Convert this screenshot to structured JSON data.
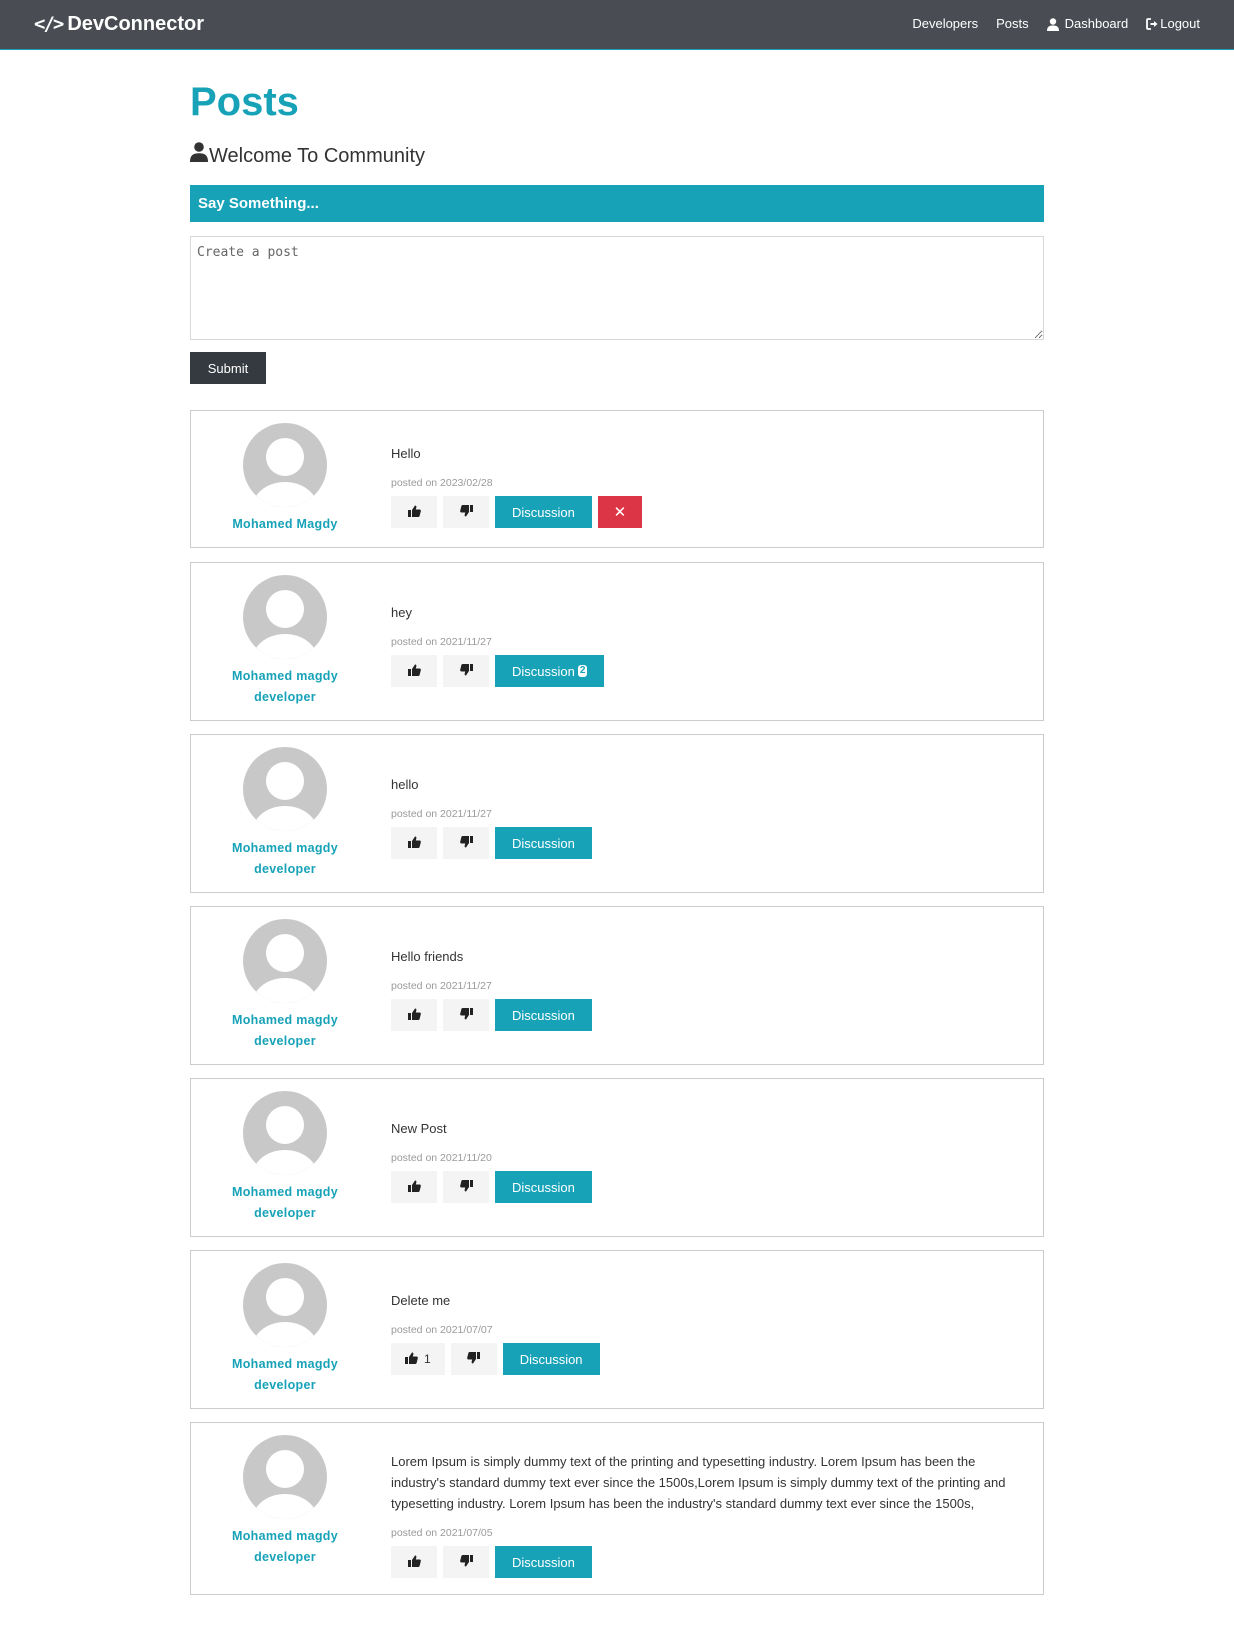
{
  "navbar": {
    "brand": "DevConnector",
    "links": [
      {
        "label": "Developers"
      },
      {
        "label": "Posts"
      },
      {
        "label": "Dashboard"
      },
      {
        "label": "Logout"
      }
    ]
  },
  "page": {
    "title": "Posts",
    "lead": "Welcome To Community"
  },
  "form": {
    "header": "Say Something...",
    "placeholder": "Create a post",
    "submit_label": "Submit"
  },
  "posts": [
    {
      "name": "Mohamed Magdy",
      "role": "",
      "text": "Hello",
      "date": "posted on 2023/02/28",
      "likes": "",
      "discussion": "Discussion",
      "comments": "",
      "deletable": true
    },
    {
      "name": "Mohamed magdy",
      "role": "developer",
      "text": "hey",
      "date": "posted on 2021/11/27",
      "likes": "",
      "discussion": "Discussion",
      "comments": "2",
      "deletable": false
    },
    {
      "name": "Mohamed magdy",
      "role": "developer",
      "text": "hello",
      "date": "posted on 2021/11/27",
      "likes": "",
      "discussion": "Discussion",
      "comments": "",
      "deletable": false
    },
    {
      "name": "Mohamed magdy",
      "role": "developer",
      "text": "Hello friends",
      "date": "posted on 2021/11/27",
      "likes": "",
      "discussion": "Discussion",
      "comments": "",
      "deletable": false
    },
    {
      "name": "Mohamed magdy",
      "role": "developer",
      "text": "New Post",
      "date": "posted on 2021/11/20",
      "likes": "",
      "discussion": "Discussion",
      "comments": "",
      "deletable": false
    },
    {
      "name": "Mohamed magdy",
      "role": "developer",
      "text": "Delete me",
      "date": "posted on 2021/07/07",
      "likes": "1",
      "discussion": "Discussion",
      "comments": "",
      "deletable": false
    },
    {
      "name": "Mohamed magdy",
      "role": "developer",
      "text": "Lorem Ipsum is simply dummy text of the printing and typesetting industry. Lorem Ipsum has been the industry's standard dummy text ever since the 1500s,Lorem Ipsum is simply dummy text of the printing and typesetting industry. Lorem Ipsum has been the industry's standard dummy text ever since the 1500s,",
      "date": "posted on 2021/07/05",
      "likes": "",
      "discussion": "Discussion",
      "comments": "",
      "deletable": false
    }
  ],
  "colors": {
    "primary": "#17a2b8",
    "navbar": "#494d53",
    "dark": "#343a40",
    "danger": "#dc3545"
  },
  "icons": {
    "brand": "code-icon",
    "dashboard": "user-icon",
    "logout": "sign-out-icon",
    "lead": "user-icon",
    "like": "thumbs-up-icon",
    "dislike": "thumbs-down-icon",
    "delete": "times-icon"
  }
}
